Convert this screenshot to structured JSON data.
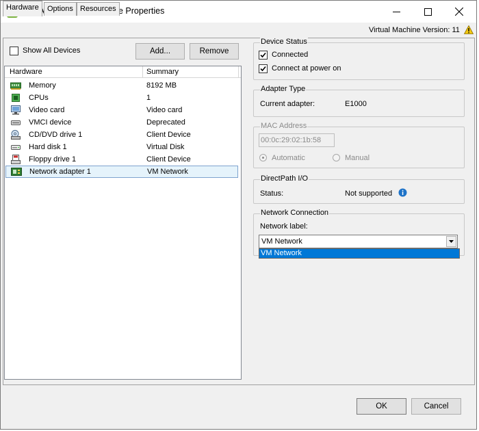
{
  "window": {
    "title": "CASAVM - Virtual Machine Properties",
    "version_label": "Virtual Machine Version: 11"
  },
  "tabs": [
    {
      "label": "Hardware",
      "active": true
    },
    {
      "label": "Options",
      "active": false
    },
    {
      "label": "Resources",
      "active": false
    }
  ],
  "hardware_panel": {
    "show_all_devices_label": "Show All Devices",
    "show_all_devices_checked": false,
    "add_button": "Add...",
    "remove_button": "Remove",
    "columns": [
      "Hardware",
      "Summary"
    ],
    "rows": [
      {
        "icon": "memory-icon",
        "name": "Memory",
        "summary": "8192 MB",
        "selected": false
      },
      {
        "icon": "cpu-icon",
        "name": "CPUs",
        "summary": "1",
        "selected": false
      },
      {
        "icon": "video-card-icon",
        "name": "Video card",
        "summary": "Video card",
        "selected": false
      },
      {
        "icon": "vmci-device-icon",
        "name": "VMCI device",
        "summary": "Deprecated",
        "selected": false
      },
      {
        "icon": "cd-dvd-drive-icon",
        "name": "CD/DVD drive 1",
        "summary": "Client Device",
        "selected": false
      },
      {
        "icon": "hard-disk-icon",
        "name": "Hard disk 1",
        "summary": "Virtual Disk",
        "selected": false
      },
      {
        "icon": "floppy-drive-icon",
        "name": "Floppy drive 1",
        "summary": "Client Device",
        "selected": false
      },
      {
        "icon": "network-adapter-icon",
        "name": "Network adapter 1",
        "summary": "VM Network",
        "selected": true
      }
    ]
  },
  "device_status": {
    "title": "Device Status",
    "connected_label": "Connected",
    "connected_checked": true,
    "power_on_label": "Connect at power on",
    "power_on_checked": true
  },
  "adapter_type": {
    "title": "Adapter Type",
    "current_label": "Current adapter:",
    "current_value": "E1000"
  },
  "mac_address": {
    "title": "MAC Address",
    "value": "00:0c:29:02:1b:58",
    "automatic_label": "Automatic",
    "manual_label": "Manual",
    "selected": "automatic"
  },
  "directpath": {
    "title": "DirectPath I/O",
    "status_label": "Status:",
    "status_value": "Not supported"
  },
  "network_connection": {
    "title": "Network Connection",
    "label": "Network label:",
    "selected_value": "VM Network",
    "options": [
      "VM Network"
    ]
  },
  "footer": {
    "ok": "OK",
    "cancel": "Cancel"
  },
  "colors": {
    "selection": "#0078d7",
    "row_highlight": "#e5f3fb",
    "info": "#1e73c8",
    "warning": "#f2c811"
  }
}
